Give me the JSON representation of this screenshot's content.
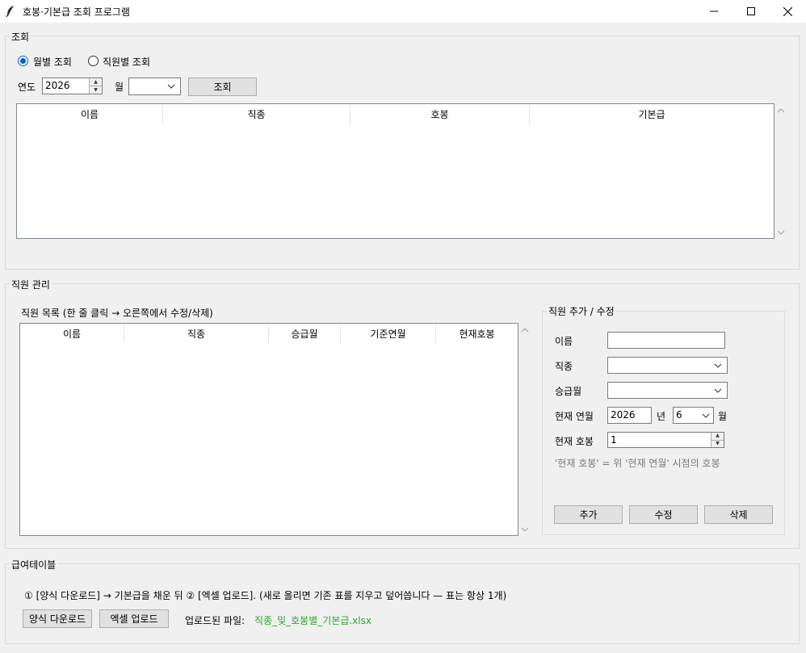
{
  "window": {
    "title": "호봉·기본급 조회 프로그램",
    "minimize_glyph": "—",
    "maximize_glyph": "☐",
    "close_glyph": "✕",
    "app_icon": "feather-icon"
  },
  "lookup": {
    "group_label": "조회",
    "radio_monthly": "월별 조회",
    "radio_employee": "직원별 조회",
    "selected_mode": "월별 조회",
    "year_label": "연도",
    "year_value": "2026",
    "month_label": "월",
    "month_value": "",
    "search_button": "조회",
    "columns": [
      "이름",
      "직종",
      "호봉",
      "기본급"
    ],
    "rows": []
  },
  "staff": {
    "group_label": "직원 관리",
    "list_label": "직원 목록 (한 줄 클릭 → 오른쪽에서 수정/삭제)",
    "columns": [
      "이름",
      "직종",
      "승급월",
      "기준연월",
      "현재호봉"
    ],
    "rows": [],
    "form": {
      "group_label": "직원 추가 / 수정",
      "name_label": "이름",
      "name_value": "",
      "job_label": "직종",
      "job_value": "",
      "promo_label": "승급월",
      "promo_value": "",
      "current_ym_label": "현재 연월",
      "current_year": "2026",
      "year_suffix": "년",
      "current_month": "6",
      "month_suffix": "월",
      "current_step_label": "현재 호봉",
      "current_step_value": "1",
      "hint": "'현재 호봉' = 위 '현재 연월' 시점의 호봉",
      "add_button": "추가",
      "edit_button": "수정",
      "delete_button": "삭제"
    }
  },
  "salary_table": {
    "group_label": "급여테이블",
    "instructions": "① [양식 다운로드] → 기본급을 채운 뒤  ② [엑셀 업로드].  (새로 올리면 기존 표를 지우고 덮어씁니다 — 표는 항상 1개)",
    "download_button": "양식 다운로드",
    "upload_button": "엑셀 업로드",
    "uploaded_label": "업로드된 파일:",
    "uploaded_file": "직종_및_호봉별_기본급.xlsx"
  }
}
